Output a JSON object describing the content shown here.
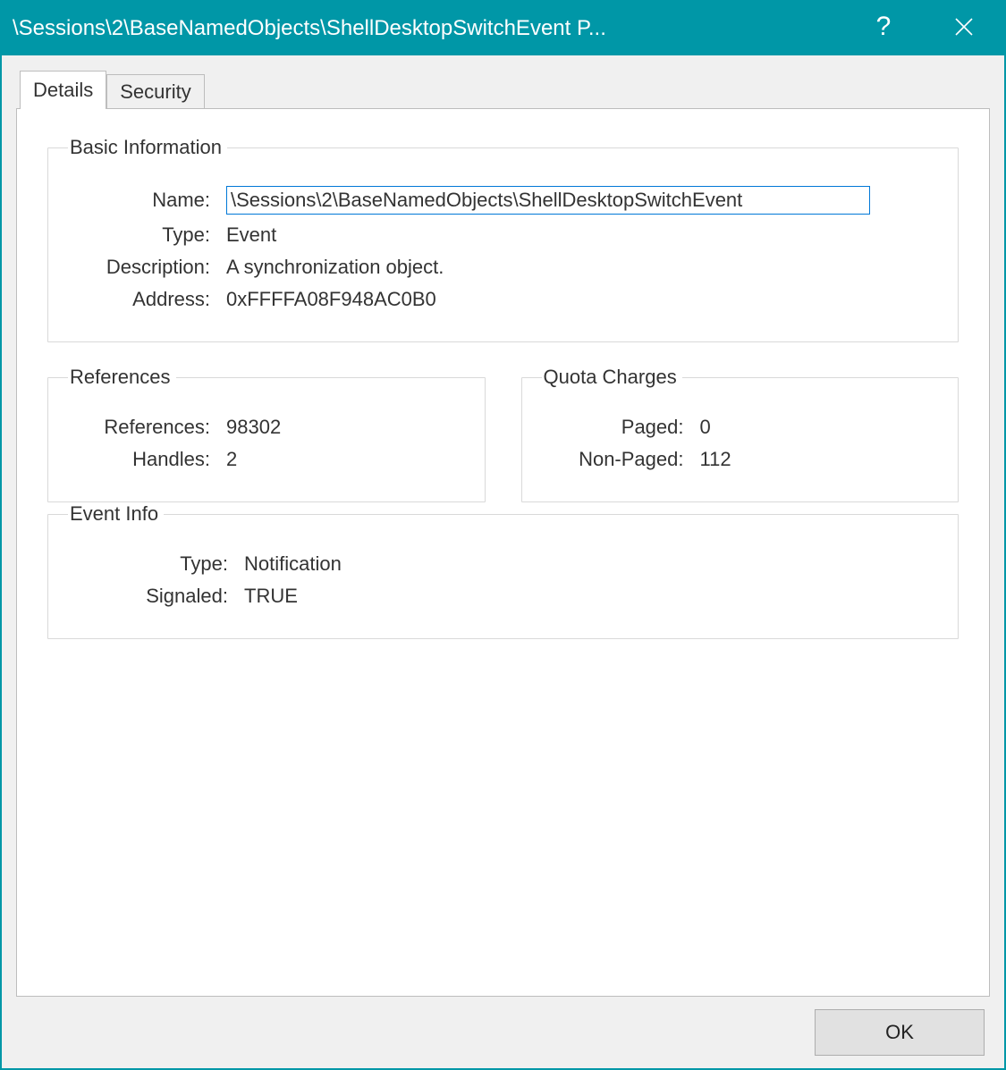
{
  "window": {
    "title": "\\Sessions\\2\\BaseNamedObjects\\ShellDesktopSwitchEvent P..."
  },
  "tabs": {
    "details": "Details",
    "security": "Security"
  },
  "groups": {
    "basic": {
      "legend": "Basic Information",
      "name_label": "Name:",
      "name_value": "\\Sessions\\2\\BaseNamedObjects\\ShellDesktopSwitchEvent",
      "type_label": "Type:",
      "type_value": "Event",
      "description_label": "Description:",
      "description_value": "A synchronization object.",
      "address_label": "Address:",
      "address_value": "0xFFFFA08F948AC0B0"
    },
    "references": {
      "legend": "References",
      "references_label": "References:",
      "references_value": "98302",
      "handles_label": "Handles:",
      "handles_value": "2"
    },
    "quota": {
      "legend": "Quota Charges",
      "paged_label": "Paged:",
      "paged_value": "0",
      "nonpaged_label": "Non-Paged:",
      "nonpaged_value": "112"
    },
    "eventinfo": {
      "legend": "Event Info",
      "type_label": "Type:",
      "type_value": "Notification",
      "signaled_label": "Signaled:",
      "signaled_value": "TRUE"
    }
  },
  "buttons": {
    "ok": "OK"
  }
}
